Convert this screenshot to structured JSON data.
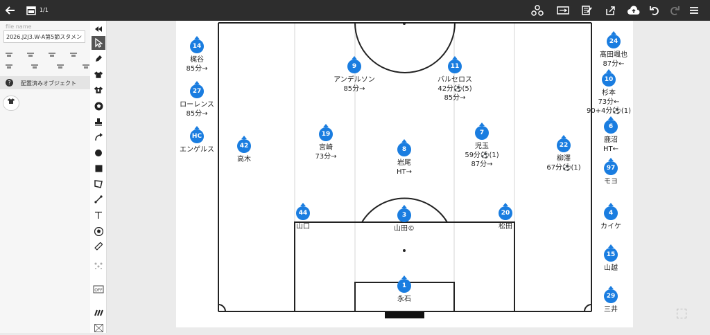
{
  "topbar": {
    "back_icon": "arrow-left-icon",
    "page_count": "1/1",
    "right_icons": [
      "network-icon",
      "swap-icon",
      "edit-notes-icon",
      "share-icon",
      "cloud-upload-icon",
      "undo-icon",
      "redo-icon",
      "menu-icon"
    ]
  },
  "left_panel": {
    "file_name_label": "file name",
    "file_name_value": "2026.J2J3.W-A第5節スタメン",
    "placed_objects_label": "配置済みオブジェクト"
  },
  "toolbar": {
    "tools": [
      "collapse-icon",
      "select-pointer-icon",
      "pen-icon",
      "shirt-black-icon",
      "shirt-black-alt-icon",
      "ball-icon",
      "stamp-icon",
      "curve-arrow-icon",
      "circle-icon",
      "square-icon",
      "polygon-icon",
      "line-icon",
      "text-icon",
      "ball-alt-icon",
      "ruler-icon",
      "formation-icon",
      "off-toggle-icon",
      "grid-icon",
      "pattern-icon"
    ]
  },
  "colors": {
    "player_chip": "#1a7de0",
    "topbar": "#2d2d2d",
    "pitch_lines": "#222222"
  },
  "players": [
    {
      "number": "14",
      "name": "梶谷",
      "notes": [
        "85分→"
      ]
    },
    {
      "number": "27",
      "name": "ローレンス",
      "notes": [
        "85分→"
      ]
    },
    {
      "number": "HC",
      "name": "エンゲルス",
      "notes": []
    },
    {
      "number": "42",
      "name": "高木",
      "notes": []
    },
    {
      "number": "9",
      "name": "アンデルソン",
      "notes": [
        "85分→"
      ]
    },
    {
      "number": "11",
      "name": "バルセロス",
      "notes": [
        "42分⚽(5)",
        "85分→"
      ]
    },
    {
      "number": "19",
      "name": "宮崎",
      "notes": [
        "73分→"
      ]
    },
    {
      "number": "8",
      "name": "岩尾",
      "notes": [
        "HT→"
      ]
    },
    {
      "number": "7",
      "name": "児玉",
      "notes": [
        "59分⚽(1)",
        "87分→"
      ]
    },
    {
      "number": "22",
      "name": "柳澤",
      "notes": [
        "67分⚽(1)"
      ]
    },
    {
      "number": "44",
      "name": "山口",
      "notes": []
    },
    {
      "number": "3",
      "name": "山田©",
      "notes": []
    },
    {
      "number": "20",
      "name": "松田",
      "notes": []
    },
    {
      "number": "1",
      "name": "永石",
      "notes": []
    },
    {
      "number": "24",
      "name": "髙田颯也",
      "notes": [
        "87分←"
      ]
    },
    {
      "number": "10",
      "name": "杉本",
      "notes": [
        "73分←",
        "90+4分⚽(1)"
      ]
    },
    {
      "number": "6",
      "name": "鹿沼",
      "notes": [
        "HT←"
      ]
    },
    {
      "number": "97",
      "name": "モヨ",
      "notes": []
    },
    {
      "number": "4",
      "name": "カイケ",
      "notes": []
    },
    {
      "number": "15",
      "name": "山越",
      "notes": []
    },
    {
      "number": "29",
      "name": "三井",
      "notes": []
    }
  ]
}
